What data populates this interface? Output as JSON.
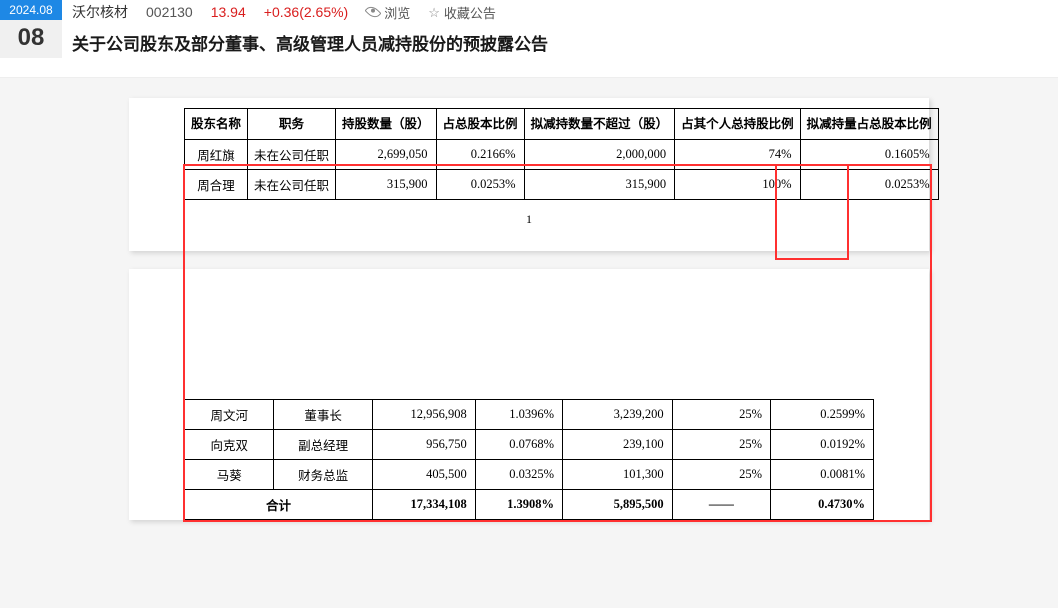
{
  "header": {
    "month": "2024.08",
    "day": "08",
    "stock_name": "沃尔核材",
    "stock_code": "002130",
    "price": "13.94",
    "change": "+0.36(2.65%)",
    "browse_label": "浏览",
    "favorite_label": "收藏公告",
    "title": "关于公司股东及部分董事、高级管理人员减持股份的预披露公告"
  },
  "table1": {
    "headers": {
      "h0": "股东名称",
      "h1": "职务",
      "h2": "持股数量（股）",
      "h3": "占总股本比例",
      "h4": "拟减持数量不超过（股）",
      "h5": "占其个人总持股比例",
      "h6": "拟减持量占总股本比例"
    },
    "r0": {
      "c0": "周红旗",
      "c1": "未在公司任职",
      "c2": "2,699,050",
      "c3": "0.2166%",
      "c4": "2,000,000",
      "c5": "74%",
      "c6": "0.1605%"
    },
    "r1": {
      "c0": "周合理",
      "c1": "未在公司任职",
      "c2": "315,900",
      "c3": "0.0253%",
      "c4": "315,900",
      "c5": "100%",
      "c6": "0.0253%"
    }
  },
  "page_number_1": "1",
  "table2": {
    "r0": {
      "c0": "周文河",
      "c1": "董事长",
      "c2": "12,956,908",
      "c3": "1.0396%",
      "c4": "3,239,200",
      "c5": "25%",
      "c6": "0.2599%"
    },
    "r1": {
      "c0": "向克双",
      "c1": "副总经理",
      "c2": "956,750",
      "c3": "0.0768%",
      "c4": "239,100",
      "c5": "25%",
      "c6": "0.0192%"
    },
    "r2": {
      "c0": "马葵",
      "c1": "财务总监",
      "c2": "405,500",
      "c3": "0.0325%",
      "c4": "101,300",
      "c5": "25%",
      "c6": "0.0081%"
    },
    "total": {
      "label": "合计",
      "c2": "17,334,108",
      "c3": "1.3908%",
      "c4": "5,895,500",
      "c5": "——",
      "c6": "0.4730%"
    }
  }
}
